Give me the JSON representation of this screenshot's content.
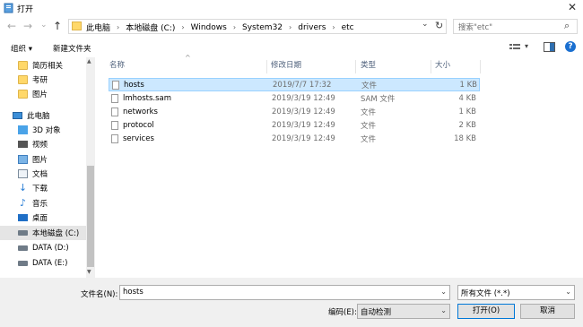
{
  "window": {
    "title": "打开",
    "close": "✕"
  },
  "nav": {
    "back": "←",
    "forward": "→",
    "dropdown": "⌄",
    "up": "↑",
    "refresh": "↻"
  },
  "address": {
    "crumbs": [
      "此电脑",
      "本地磁盘 (C:)",
      "Windows",
      "System32",
      "drivers",
      "etc"
    ],
    "separator": "›",
    "dropdown": "⌄"
  },
  "search": {
    "placeholder": "搜索\"etc\"",
    "icon": "⌕"
  },
  "toolbar": {
    "organize": "组织 ▾",
    "new_folder": "新建文件夹",
    "view_menu": "▾",
    "help": "?"
  },
  "sidebar": {
    "items": [
      {
        "label": "简历相关",
        "icon": "folder-icon"
      },
      {
        "label": "考研",
        "icon": "folder-icon"
      },
      {
        "label": "图片",
        "icon": "folder-icon"
      },
      {
        "label": "此电脑",
        "icon": "computer-icon"
      },
      {
        "label": "3D 对象",
        "icon": "3d-objects-icon"
      },
      {
        "label": "视频",
        "icon": "video-icon"
      },
      {
        "label": "图片",
        "icon": "pictures-icon"
      },
      {
        "label": "文档",
        "icon": "document-icon"
      },
      {
        "label": "下载",
        "icon": "download-icon"
      },
      {
        "label": "音乐",
        "icon": "music-icon"
      },
      {
        "label": "桌面",
        "icon": "desktop-icon"
      },
      {
        "label": "本地磁盘 (C:)",
        "icon": "drive-icon",
        "selected": true
      },
      {
        "label": "DATA (D:)",
        "icon": "drive-icon"
      },
      {
        "label": "DATA (E:)",
        "icon": "drive-icon"
      }
    ],
    "scroll_up": "▲",
    "scroll_down": "▼"
  },
  "columns": {
    "name": "名称",
    "date": "修改日期",
    "type": "类型",
    "size": "大小",
    "sort_indicator": "^"
  },
  "files": [
    {
      "name": "hosts",
      "date": "2019/7/7 17:32",
      "type": "文件",
      "size": "1 KB",
      "selected": true
    },
    {
      "name": "lmhosts.sam",
      "date": "2019/3/19 12:49",
      "type": "SAM 文件",
      "size": "4 KB"
    },
    {
      "name": "networks",
      "date": "2019/3/19 12:49",
      "type": "文件",
      "size": "1 KB"
    },
    {
      "name": "protocol",
      "date": "2019/3/19 12:49",
      "type": "文件",
      "size": "2 KB"
    },
    {
      "name": "services",
      "date": "2019/3/19 12:49",
      "type": "文件",
      "size": "18 KB"
    }
  ],
  "bottom": {
    "filename_label": "文件名(N):",
    "filename_value": "hosts",
    "filter_value": "所有文件 (*.*)",
    "encoding_label": "编码(E):",
    "encoding_value": "自动检测",
    "open_button": "打开(O)",
    "cancel_button": "取消"
  },
  "colors": {
    "selection": "#cce8ff",
    "folder": "#ffd86a",
    "accent": "#0078d7"
  }
}
